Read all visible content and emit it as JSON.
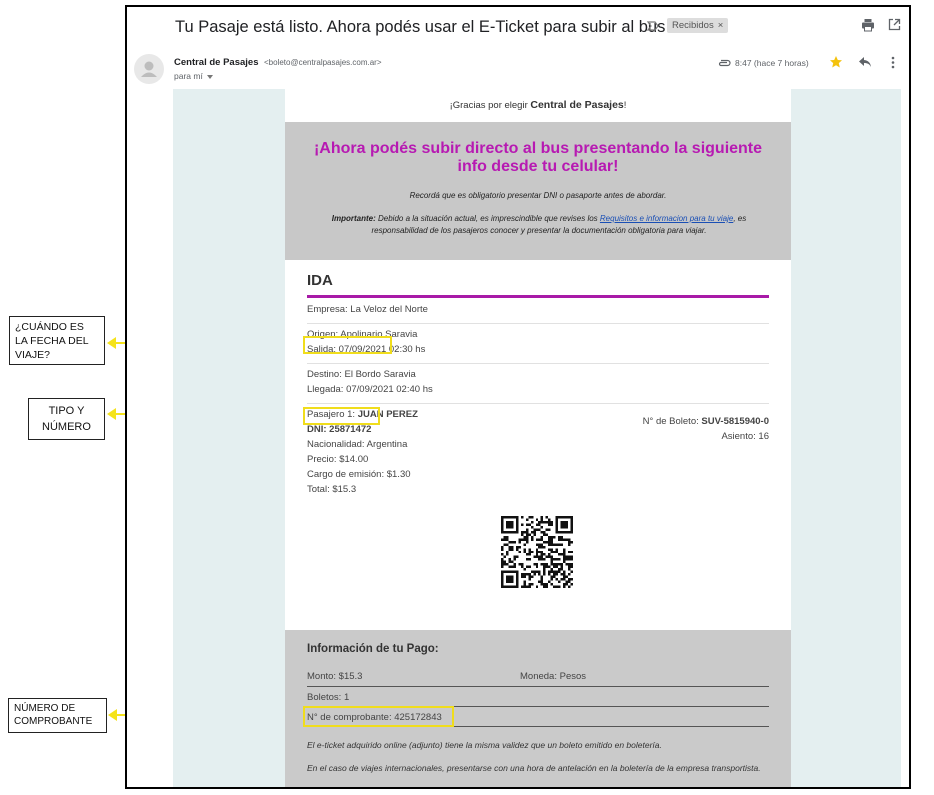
{
  "email": {
    "subject": "Tu Pasaje está listo. Ahora podés usar el E-Ticket para subir al bus",
    "label": "Recibidos",
    "label_close": "×",
    "sender_name": "Central de Pasajes",
    "sender_email": "<boleto@centralpasajes.com.ar>",
    "to": "para mí",
    "time": "8:47 (hace 7 horas)",
    "icons": [
      "important-arrow-icon",
      "print-icon",
      "open-in-new-window-icon",
      "avatar-icon",
      "attachment-icon",
      "star-icon",
      "reply-icon",
      "more-options-icon"
    ],
    "accent_colors": {
      "magenta": "#b71ab2",
      "rule": "#a81aa7",
      "star": "#f4c20d",
      "highlight": "#f0dd1c",
      "link": "#1a4fb5"
    }
  },
  "body": {
    "thanks_prefix": "¡Gracias por elegir ",
    "thanks_brand": "Central de Pasajes",
    "thanks_suffix": "!",
    "banner_title": "¡Ahora podés subir directo al bus presentando la siguiente info desde tu celular!",
    "banner_note": "Recordá que es obligatorio presentar DNI o pasaporte antes de abordar.",
    "important_label": "Importante:",
    "important_text_1": " Debido a la situación actual, es imprescindible que revises los ",
    "important_link": "Requisitos e informacion para tu viaje",
    "important_text_2": ", es responsabilidad de los pasajeros conocer y presentar la documentación obligatoria para viajar."
  },
  "trip": {
    "title": "IDA",
    "company": "Empresa: La Veloz del Norte",
    "origin": "Origen: Apolinario Saravia",
    "departure_date": "Salida: 07/09/2021",
    "departure_time": " 02:30 hs",
    "destination": "Destino: El Bordo Saravia",
    "arrival": "Llegada: 07/09/2021 02:40 hs",
    "passenger_label": "Pasajero 1: ",
    "passenger_name": "JUAN PEREZ",
    "dni_label": "DNI: ",
    "dni_number": "25871472",
    "nationality": "Nacionalidad: Argentina",
    "price": "Precio: $14.00",
    "fee": "Cargo de emisión: $1.30",
    "total": "Total: $15.3",
    "ticket_label": "N° de Boleto: ",
    "ticket_number": "SUV-5815940-0",
    "seat": "Asiento: 16"
  },
  "payment": {
    "title": "Información de tu Pago:",
    "amount": "Monto: $15.3",
    "currency": "Moneda: Pesos",
    "tickets": "Boletos: 1",
    "voucher": "N° de comprobante: 425172843",
    "note_1": "El e-ticket adquirido online (adjunto) tiene la misma validez que un boleto emitido en boletería.",
    "note_2": "En el caso de viajes internacionales, presentarse con una hora de antelación en la boletería de la empresa transportista."
  },
  "annotations": {
    "date_question": "¿CUÁNDO ES LA FECHA DEL VIAJE?",
    "type_number": "TIPO Y NÚMERO",
    "voucher_number": "NÚMERO DE COMPROBANTE"
  }
}
